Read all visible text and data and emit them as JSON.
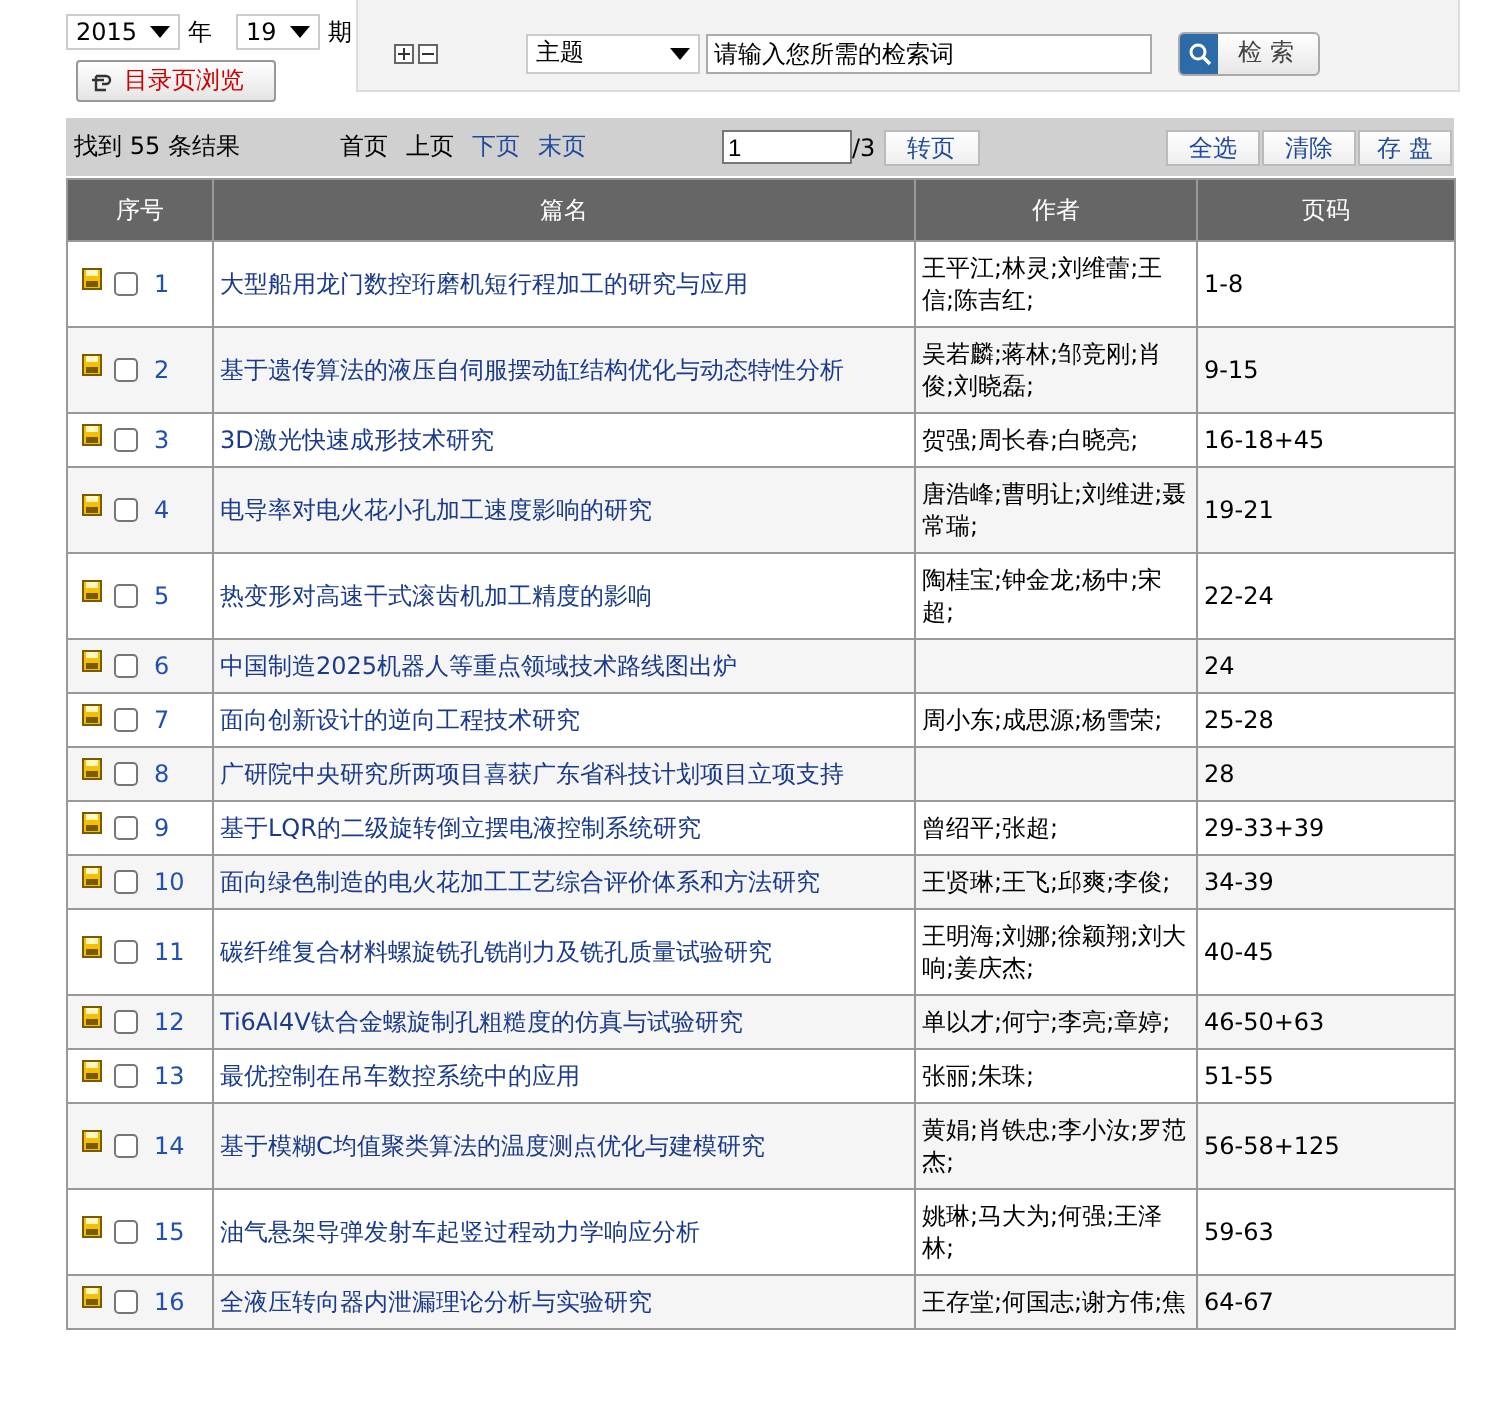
{
  "issue_picker": {
    "year": "2015",
    "year_unit": "年",
    "issue": "19",
    "issue_unit": "期"
  },
  "browse_button": "目录页浏览",
  "search": {
    "field": "主题",
    "placeholder": "请输入您所需的检索词",
    "button": "检 索"
  },
  "toolbar": {
    "result_text": "找到 55 条结果",
    "pager": [
      {
        "label": "首页",
        "disabled": true
      },
      {
        "label": "上页",
        "disabled": true
      },
      {
        "label": "下页",
        "disabled": false
      },
      {
        "label": "末页",
        "disabled": false
      }
    ],
    "page_value": "1",
    "page_total": "/3",
    "go_button": "转页",
    "actions": [
      "全选",
      "清除",
      "存 盘"
    ]
  },
  "table": {
    "columns": [
      "序号",
      "篇名",
      "作者",
      "页码"
    ],
    "rows": [
      {
        "no": "1",
        "title": "大型船用龙门数控珩磨机短行程加工的研究与应用",
        "authors": "王平江;林灵;刘维蕾;王信;陈吉红;",
        "pages": "1-8",
        "checked": false
      },
      {
        "no": "2",
        "title": "基于遗传算法的液压自伺服摆动缸结构优化与动态特性分析",
        "authors": "吴若麟;蒋林;邹竞刚;肖俊;刘晓磊;",
        "pages": "9-15",
        "checked": false
      },
      {
        "no": "3",
        "title": "3D激光快速成形技术研究",
        "authors": "贺强;周长春;白晓亮;",
        "pages": "16-18+45",
        "checked": false
      },
      {
        "no": "4",
        "title": "电导率对电火花小孔加工速度影响的研究",
        "authors": "唐浩峰;曹明让;刘维进;聂常瑞;",
        "pages": "19-21",
        "checked": false
      },
      {
        "no": "5",
        "title": "热变形对高速干式滚齿机加工精度的影响",
        "authors": "陶桂宝;钟金龙;杨中;宋超;",
        "pages": "22-24",
        "checked": false
      },
      {
        "no": "6",
        "title": "中国制造2025机器人等重点领域技术路线图出炉",
        "pages": "24",
        "checked": false
      },
      {
        "no": "7",
        "title": "面向创新设计的逆向工程技术研究",
        "authors": "周小东;成思源;杨雪荣;",
        "pages": "25-28",
        "checked": false
      },
      {
        "no": "8",
        "title": "广研院中央研究所两项目喜获广东省科技计划项目立项支持",
        "pages": "28",
        "checked": false
      },
      {
        "no": "9",
        "title": "基于LQR的二级旋转倒立摆电液控制系统研究",
        "authors": "曾绍平;张超;",
        "pages": "29-33+39",
        "checked": false
      },
      {
        "no": "10",
        "title": "面向绿色制造的电火花加工工艺综合评价体系和方法研究",
        "authors": "王贤琳;王飞;邱爽;李俊;",
        "pages": "34-39",
        "checked": false
      },
      {
        "no": "11",
        "title": "碳纤维复合材料螺旋铣孔铣削力及铣孔质量试验研究",
        "authors": "王明海;刘娜;徐颖翔;刘大响;姜庆杰;",
        "pages": "40-45",
        "checked": false
      },
      {
        "no": "12",
        "title": "Ti6Al4V钛合金螺旋制孔粗糙度的仿真与试验研究",
        "authors": "单以才;何宁;李亮;章婷;",
        "pages": "46-50+63",
        "checked": false
      },
      {
        "no": "13",
        "title": "最优控制在吊车数控系统中的应用",
        "authors": "张丽;朱珠;",
        "pages": "51-55",
        "checked": false
      },
      {
        "no": "14",
        "title": "基于模糊C均值聚类算法的温度测点优化与建模研究",
        "authors": "黄娟;肖铁忠;李小汝;罗范杰;",
        "pages": "56-58+125",
        "checked": false
      },
      {
        "no": "15",
        "title": "油气悬架导弹发射车起竖过程动力学响应分析",
        "authors": "姚琳;马大为;何强;王泽林;",
        "pages": "59-63",
        "checked": false
      },
      {
        "no": "16",
        "title": "全液压转向器内泄漏理论分析与实验研究",
        "authors": "王存堂;何国志;谢方伟;焦",
        "pages": "64-67",
        "checked": false
      }
    ]
  }
}
